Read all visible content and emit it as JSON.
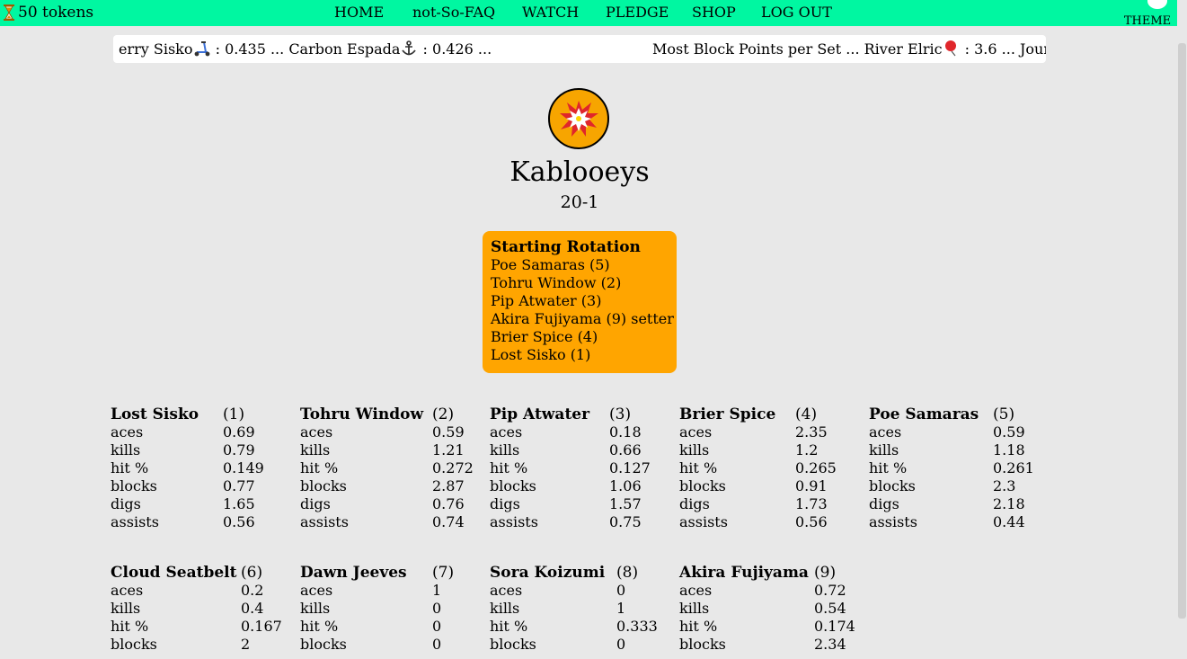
{
  "topbar": {
    "tokens_label": "50 tokens",
    "nav": [
      "HOME",
      "not-So-FAQ",
      "WATCH",
      "PLEDGE",
      "SHOP",
      "LOG OUT"
    ],
    "theme_label": "THEME",
    "bg_color": "#00f7a1"
  },
  "ticker": {
    "left_text_a": "erry Sisko",
    "left_icon_a": "scooter-icon",
    "left_text_b": " : 0.435 ... Carbon Espada",
    "left_icon_b": "anchor-icon",
    "left_text_c": " : 0.426 ...",
    "right_text_a": "Most Block Points per Set ... River Elric",
    "right_icon_a": "balloon-icon",
    "right_text_b": " : 3.6 ... Jour"
  },
  "team": {
    "logo_icon": "explosion-icon",
    "name": "Kablooeys",
    "record": "20-1",
    "accent_color": "#ffa500"
  },
  "rotation": {
    "title": "Starting Rotation",
    "players": [
      "Poe Samaras (5)",
      "Tohru Window (2)",
      "Pip Atwater (3)",
      "Akira Fujiyama (9) setter",
      "Brier Spice (4)",
      "Lost Sisko (1)"
    ]
  },
  "players": [
    {
      "name": "Lost Sisko",
      "num": "(1)",
      "stats": [
        [
          "aces",
          "0.69"
        ],
        [
          "kills",
          "0.79"
        ],
        [
          "hit %",
          "0.149"
        ],
        [
          "blocks",
          "0.77"
        ],
        [
          "digs",
          "1.65"
        ],
        [
          "assists",
          "0.56"
        ]
      ]
    },
    {
      "name": "Tohru Window",
      "num": "(2)",
      "stats": [
        [
          "aces",
          "0.59"
        ],
        [
          "kills",
          "1.21"
        ],
        [
          "hit %",
          "0.272"
        ],
        [
          "blocks",
          "2.87"
        ],
        [
          "digs",
          "0.76"
        ],
        [
          "assists",
          "0.74"
        ]
      ]
    },
    {
      "name": "Pip Atwater",
      "num": "(3)",
      "stats": [
        [
          "aces",
          "0.18"
        ],
        [
          "kills",
          "0.66"
        ],
        [
          "hit %",
          "0.127"
        ],
        [
          "blocks",
          "1.06"
        ],
        [
          "digs",
          "1.57"
        ],
        [
          "assists",
          "0.75"
        ]
      ]
    },
    {
      "name": "Brier Spice",
      "num": "(4)",
      "stats": [
        [
          "aces",
          "2.35"
        ],
        [
          "kills",
          "1.2"
        ],
        [
          "hit %",
          "0.265"
        ],
        [
          "blocks",
          "0.91"
        ],
        [
          "digs",
          "1.73"
        ],
        [
          "assists",
          "0.56"
        ]
      ]
    },
    {
      "name": "Poe Samaras",
      "num": "(5)",
      "stats": [
        [
          "aces",
          "0.59"
        ],
        [
          "kills",
          "1.18"
        ],
        [
          "hit %",
          "0.261"
        ],
        [
          "blocks",
          "2.3"
        ],
        [
          "digs",
          "2.18"
        ],
        [
          "assists",
          "0.44"
        ]
      ]
    },
    {
      "name": "Cloud Seatbelt",
      "num": "(6)",
      "stats": [
        [
          "aces",
          "0.2"
        ],
        [
          "kills",
          "0.4"
        ],
        [
          "hit %",
          "0.167"
        ],
        [
          "blocks",
          "2"
        ]
      ]
    },
    {
      "name": "Dawn Jeeves",
      "num": "(7)",
      "stats": [
        [
          "aces",
          "1"
        ],
        [
          "kills",
          "0"
        ],
        [
          "hit %",
          "0"
        ],
        [
          "blocks",
          "0"
        ]
      ]
    },
    {
      "name": "Sora Koizumi",
      "num": "(8)",
      "stats": [
        [
          "aces",
          "0"
        ],
        [
          "kills",
          "1"
        ],
        [
          "hit %",
          "0.333"
        ],
        [
          "blocks",
          "0"
        ]
      ]
    },
    {
      "name": "Akira Fujiyama",
      "num": "(9)",
      "stats": [
        [
          "aces",
          "0.72"
        ],
        [
          "kills",
          "0.54"
        ],
        [
          "hit %",
          "0.174"
        ],
        [
          "blocks",
          "2.34"
        ]
      ]
    }
  ]
}
